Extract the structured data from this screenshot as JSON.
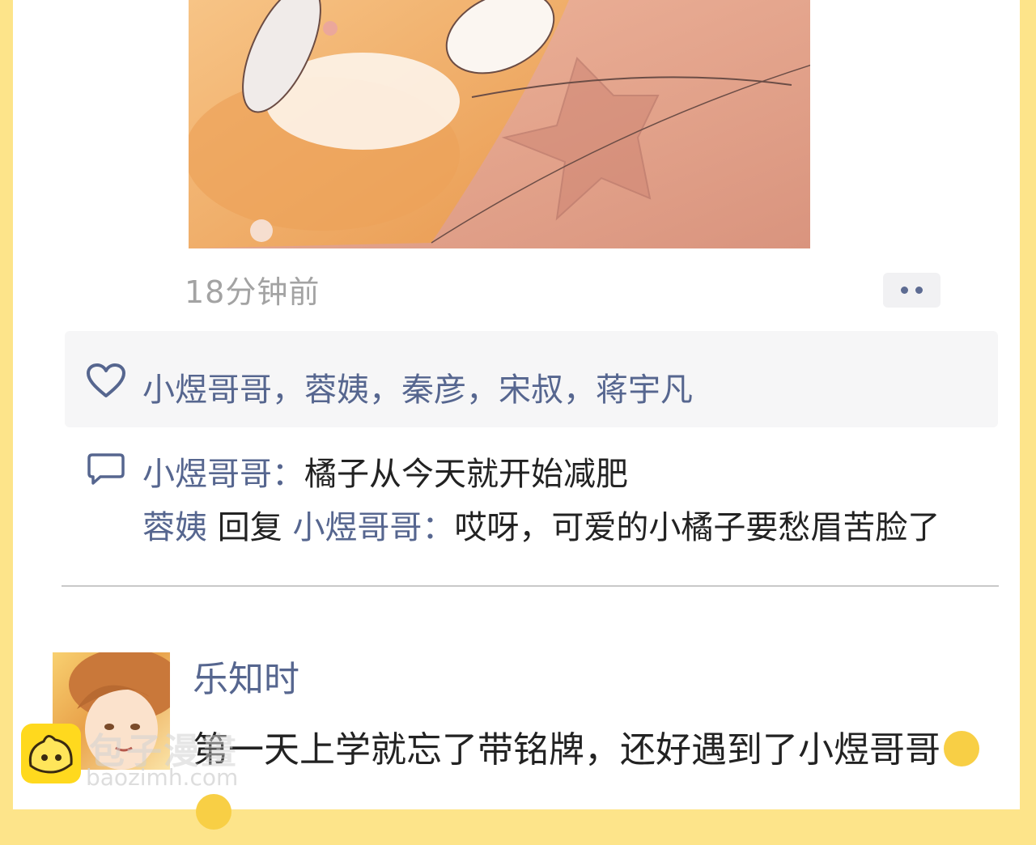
{
  "post": {
    "image": {
      "description_icon": "cat-photo"
    },
    "timestamp": "18分钟前",
    "more_icon": "more-dots-icon"
  },
  "likes": {
    "icon": "heart-icon",
    "names": "小煜哥哥，蓉姨，秦彦，宋叔，蒋宇凡"
  },
  "comments": [
    {
      "user": "小煜哥哥",
      "sep": "：",
      "text": "橘子从今天就开始减肥"
    },
    {
      "user": "蓉姨",
      "reply_word": " 回复 ",
      "reply_to": "小煜哥哥",
      "sep": "：",
      "text": "哎呀，可爱的小橘子要愁眉苦脸了"
    }
  ],
  "next_post": {
    "username": "乐知时",
    "text": "第一天上学就忘了带铭牌，还好遇到了小煜哥哥"
  },
  "watermark": {
    "title": "包子漫畫",
    "url": "baozimh.com"
  },
  "colors": {
    "background": "#fde48a",
    "username": "#56668f",
    "timestamp": "#a3a3a3"
  }
}
